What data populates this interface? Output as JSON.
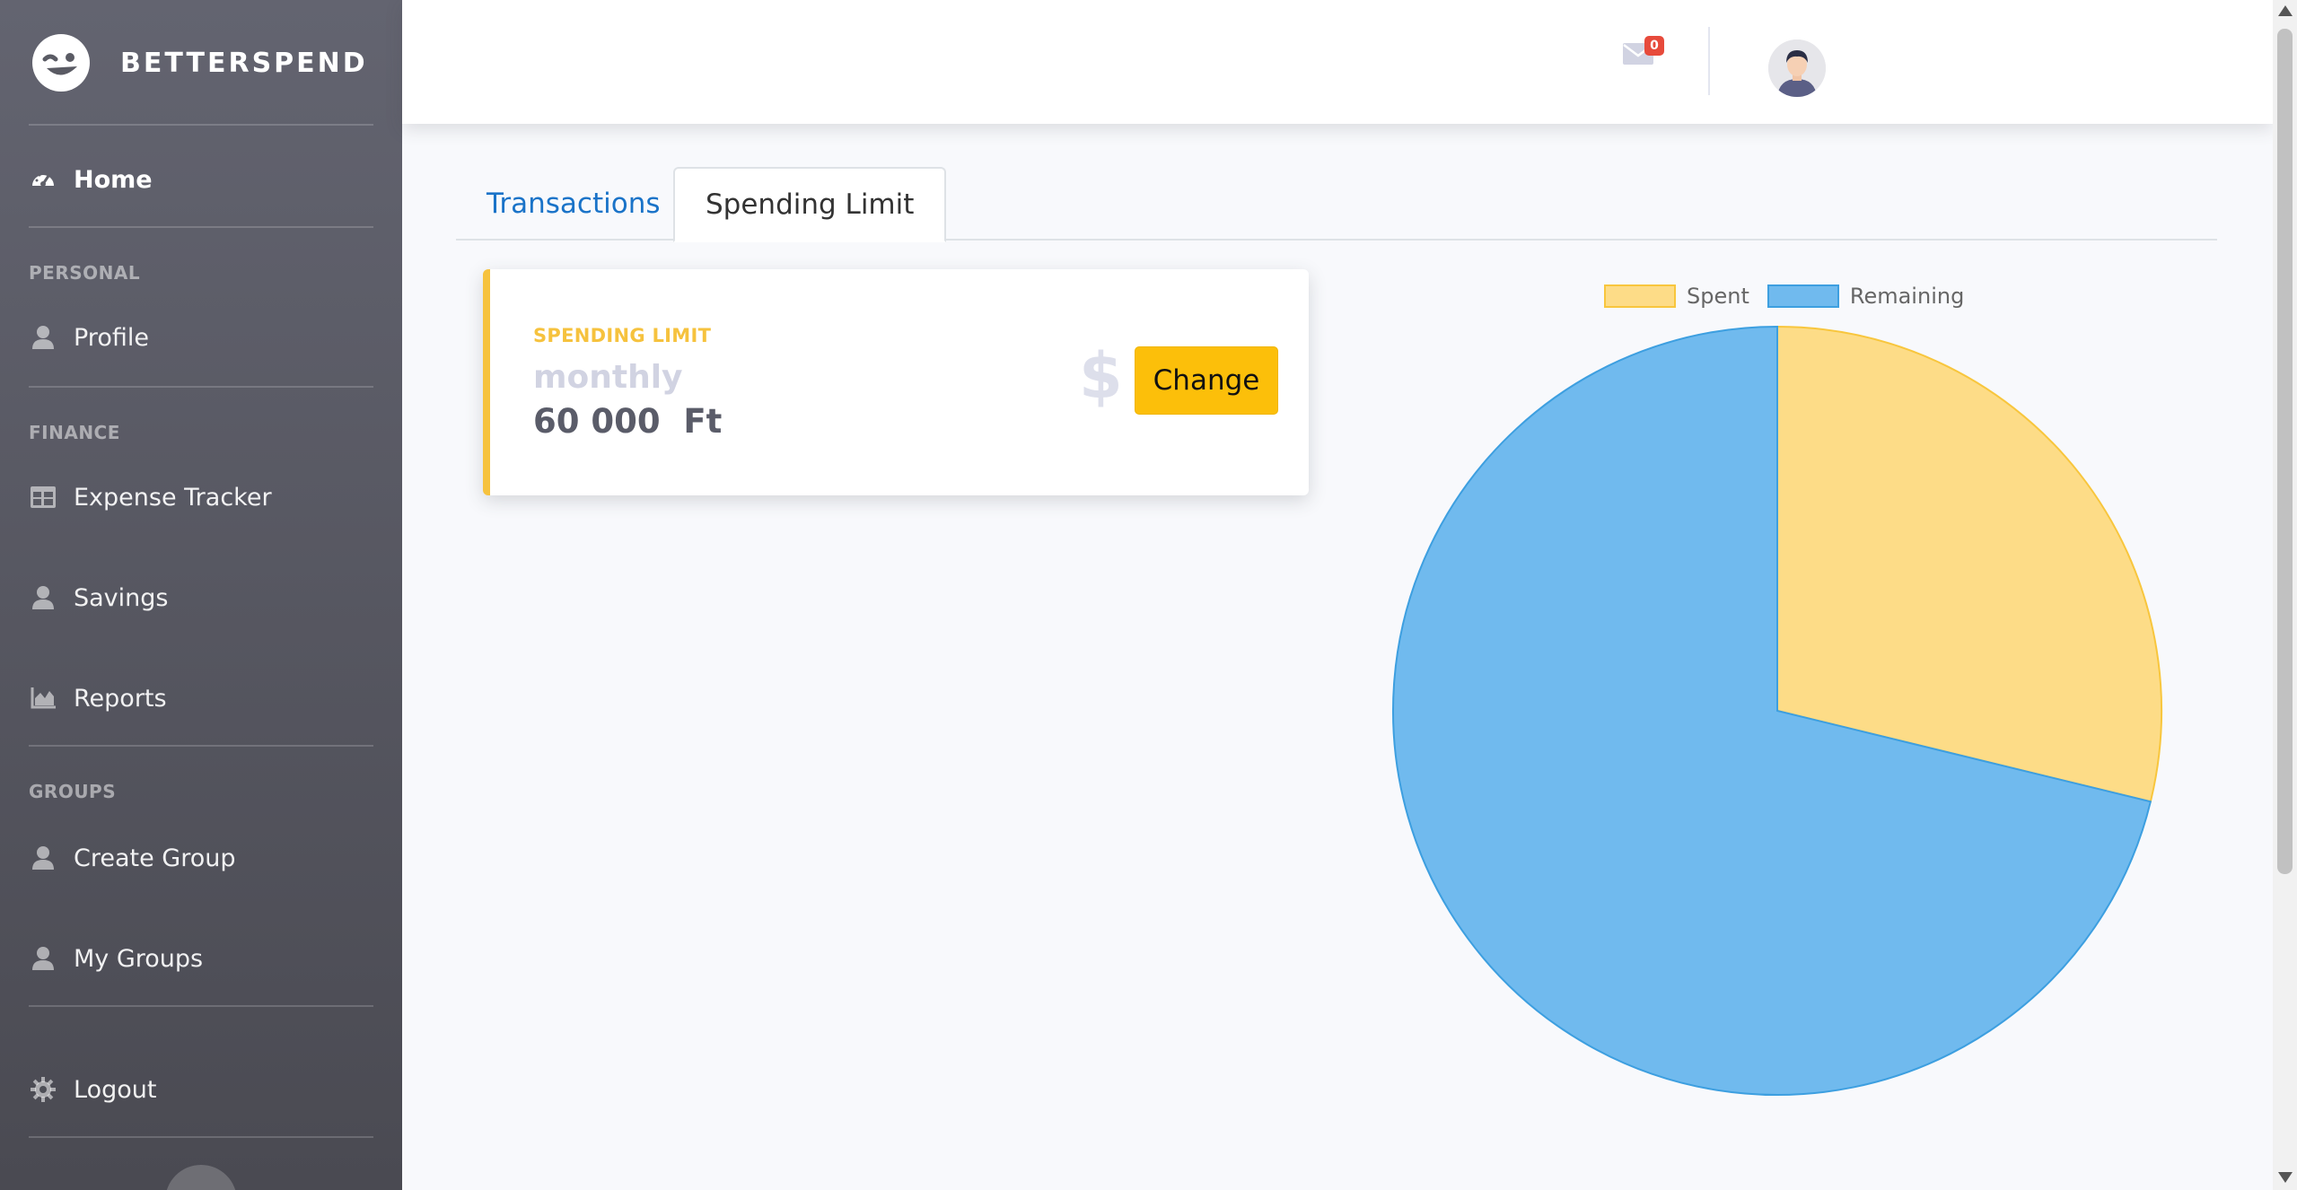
{
  "brand": {
    "name": "BETTERSPEND",
    "logo_icon": "winking-face-icon"
  },
  "sidebar": {
    "home": {
      "label": "Home",
      "icon": "tachometer-icon"
    },
    "sections": {
      "personal": "PERSONAL",
      "finance": "FINANCE",
      "groups": "GROUPS"
    },
    "items": [
      {
        "label": "Profile",
        "icon": "user-icon"
      },
      {
        "label": "Expense Tracker",
        "icon": "table-icon"
      },
      {
        "label": "Savings",
        "icon": "user-icon"
      },
      {
        "label": "Reports",
        "icon": "area-chart-icon"
      },
      {
        "label": "Create Group",
        "icon": "user-icon"
      },
      {
        "label": "My Groups",
        "icon": "user-icon"
      }
    ],
    "logout": {
      "label": "Logout",
      "icon": "gear-icon"
    }
  },
  "topbar": {
    "mail_icon": "envelope-icon",
    "mail_badge": "0",
    "avatar_icon": "user-avatar-icon"
  },
  "tabs": [
    {
      "label": "Transactions",
      "active": false
    },
    {
      "label": "Spending Limit",
      "active": true
    }
  ],
  "card": {
    "title": "SPENDING LIMIT",
    "period": "monthly",
    "amount": "60 000  Ft",
    "currency_icon": "dollar-icon",
    "button_label": "Change"
  },
  "colors": {
    "accent_warning": "#f6c23e",
    "button": "#fcbf0a",
    "spent_fill": "#fddc87",
    "spent_border": "#f8c63d",
    "remaining_fill": "#70baee",
    "remaining_border": "#3d9fe0"
  },
  "chart_data": {
    "type": "pie",
    "legend_position": "top",
    "series": [
      {
        "name": "Spent",
        "value": 28.8
      },
      {
        "name": "Remaining",
        "value": 71.2
      }
    ]
  }
}
